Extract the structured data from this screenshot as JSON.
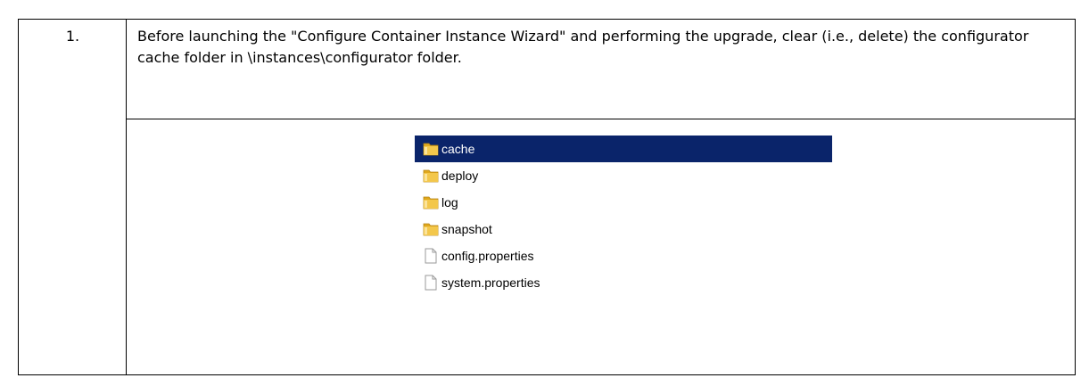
{
  "step": {
    "number": "1.",
    "instruction": "Before launching the \"Configure Container Instance Wizard\" and performing the upgrade, clear (i.e., delete) the configurator cache folder in \\instances\\configurator folder."
  },
  "explorer": {
    "items": [
      {
        "label": "cache",
        "type": "folder",
        "selected": true
      },
      {
        "label": "deploy",
        "type": "folder",
        "selected": false
      },
      {
        "label": "log",
        "type": "folder",
        "selected": false
      },
      {
        "label": "snapshot",
        "type": "folder",
        "selected": false
      },
      {
        "label": "config.properties",
        "type": "file",
        "selected": false
      },
      {
        "label": "system.properties",
        "type": "file",
        "selected": false
      }
    ]
  },
  "colors": {
    "selection": "#0a246a",
    "folder": "#f3c74b"
  }
}
